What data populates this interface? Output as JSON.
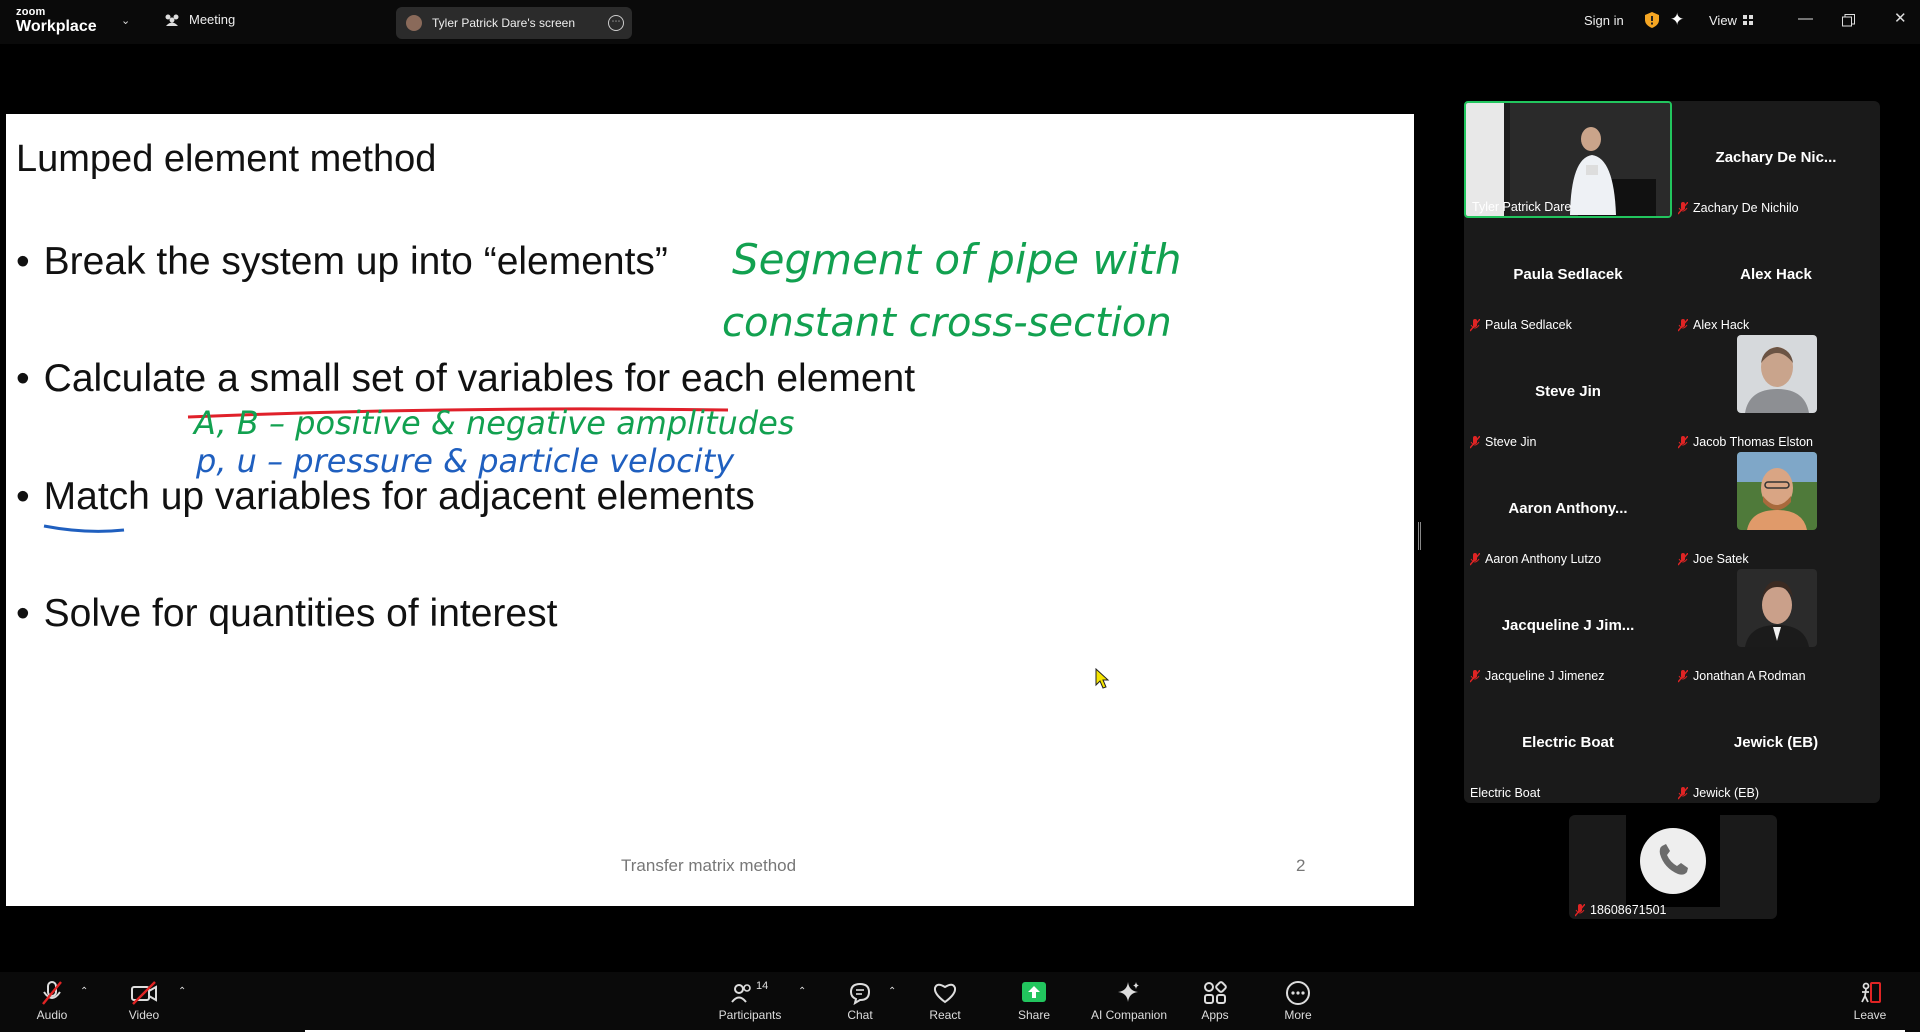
{
  "topbar": {
    "logo_line1": "zoom",
    "logo_line2": "Workplace",
    "meeting_label": "Meeting",
    "screen_share_label": "Tyler Patrick Dare's screen",
    "sign_in": "Sign in",
    "view_label": "View"
  },
  "slide": {
    "title": "Lumped element method",
    "bullets": [
      "Break the system up into “elements”",
      "Calculate a small set of variables for each element",
      "Match up variables for adjacent elements",
      "Solve for quantities of interest"
    ],
    "footer": "Transfer matrix method",
    "page_number": "2",
    "annotations": {
      "green_line1": "Segment of pipe with",
      "green_line2": "constant cross-section",
      "green_amplitudes": "A, B – positive & negative amplitudes",
      "blue_pressure": "p, u – pressure & particle velocity"
    },
    "ink_colors": {
      "green": "#12a150",
      "red": "#e0202a",
      "blue": "#1f5fbf"
    }
  },
  "gallery": {
    "tiles": [
      {
        "center": "",
        "label": "Tyler Patrick Dare",
        "muted": false
      },
      {
        "center": "Zachary De Nic...",
        "label": "Zachary De Nichilo",
        "muted": true
      },
      {
        "center": "Paula Sedlacek",
        "label": "Paula Sedlacek",
        "muted": true
      },
      {
        "center": "Alex Hack",
        "label": "Alex Hack",
        "muted": true
      },
      {
        "center": "Steve Jin",
        "label": "Steve Jin",
        "muted": true
      },
      {
        "center": "",
        "label": "Jacob Thomas Elston",
        "muted": true
      },
      {
        "center": "Aaron Anthony...",
        "label": "Aaron Anthony Lutzo",
        "muted": true
      },
      {
        "center": "",
        "label": "Joe Satek",
        "muted": true
      },
      {
        "center": "Jacqueline J Jim...",
        "label": "Jacqueline J Jimenez",
        "muted": true
      },
      {
        "center": "",
        "label": "Jonathan A Rodman",
        "muted": true
      },
      {
        "center": "Electric Boat",
        "label": "Electric Boat",
        "muted": false
      },
      {
        "center": "Jewick (EB)",
        "label": "Jewick (EB)",
        "muted": true
      }
    ],
    "phone": {
      "label": "18608671501"
    }
  },
  "toolbar": {
    "audio": "Audio",
    "video": "Video",
    "participants": "Participants",
    "participants_count": "14",
    "chat": "Chat",
    "react": "React",
    "share": "Share",
    "ai_companion": "AI Companion",
    "apps": "Apps",
    "more": "More",
    "leave": "Leave",
    "share_color": "#22c55e",
    "leave_color": "#e02424"
  }
}
